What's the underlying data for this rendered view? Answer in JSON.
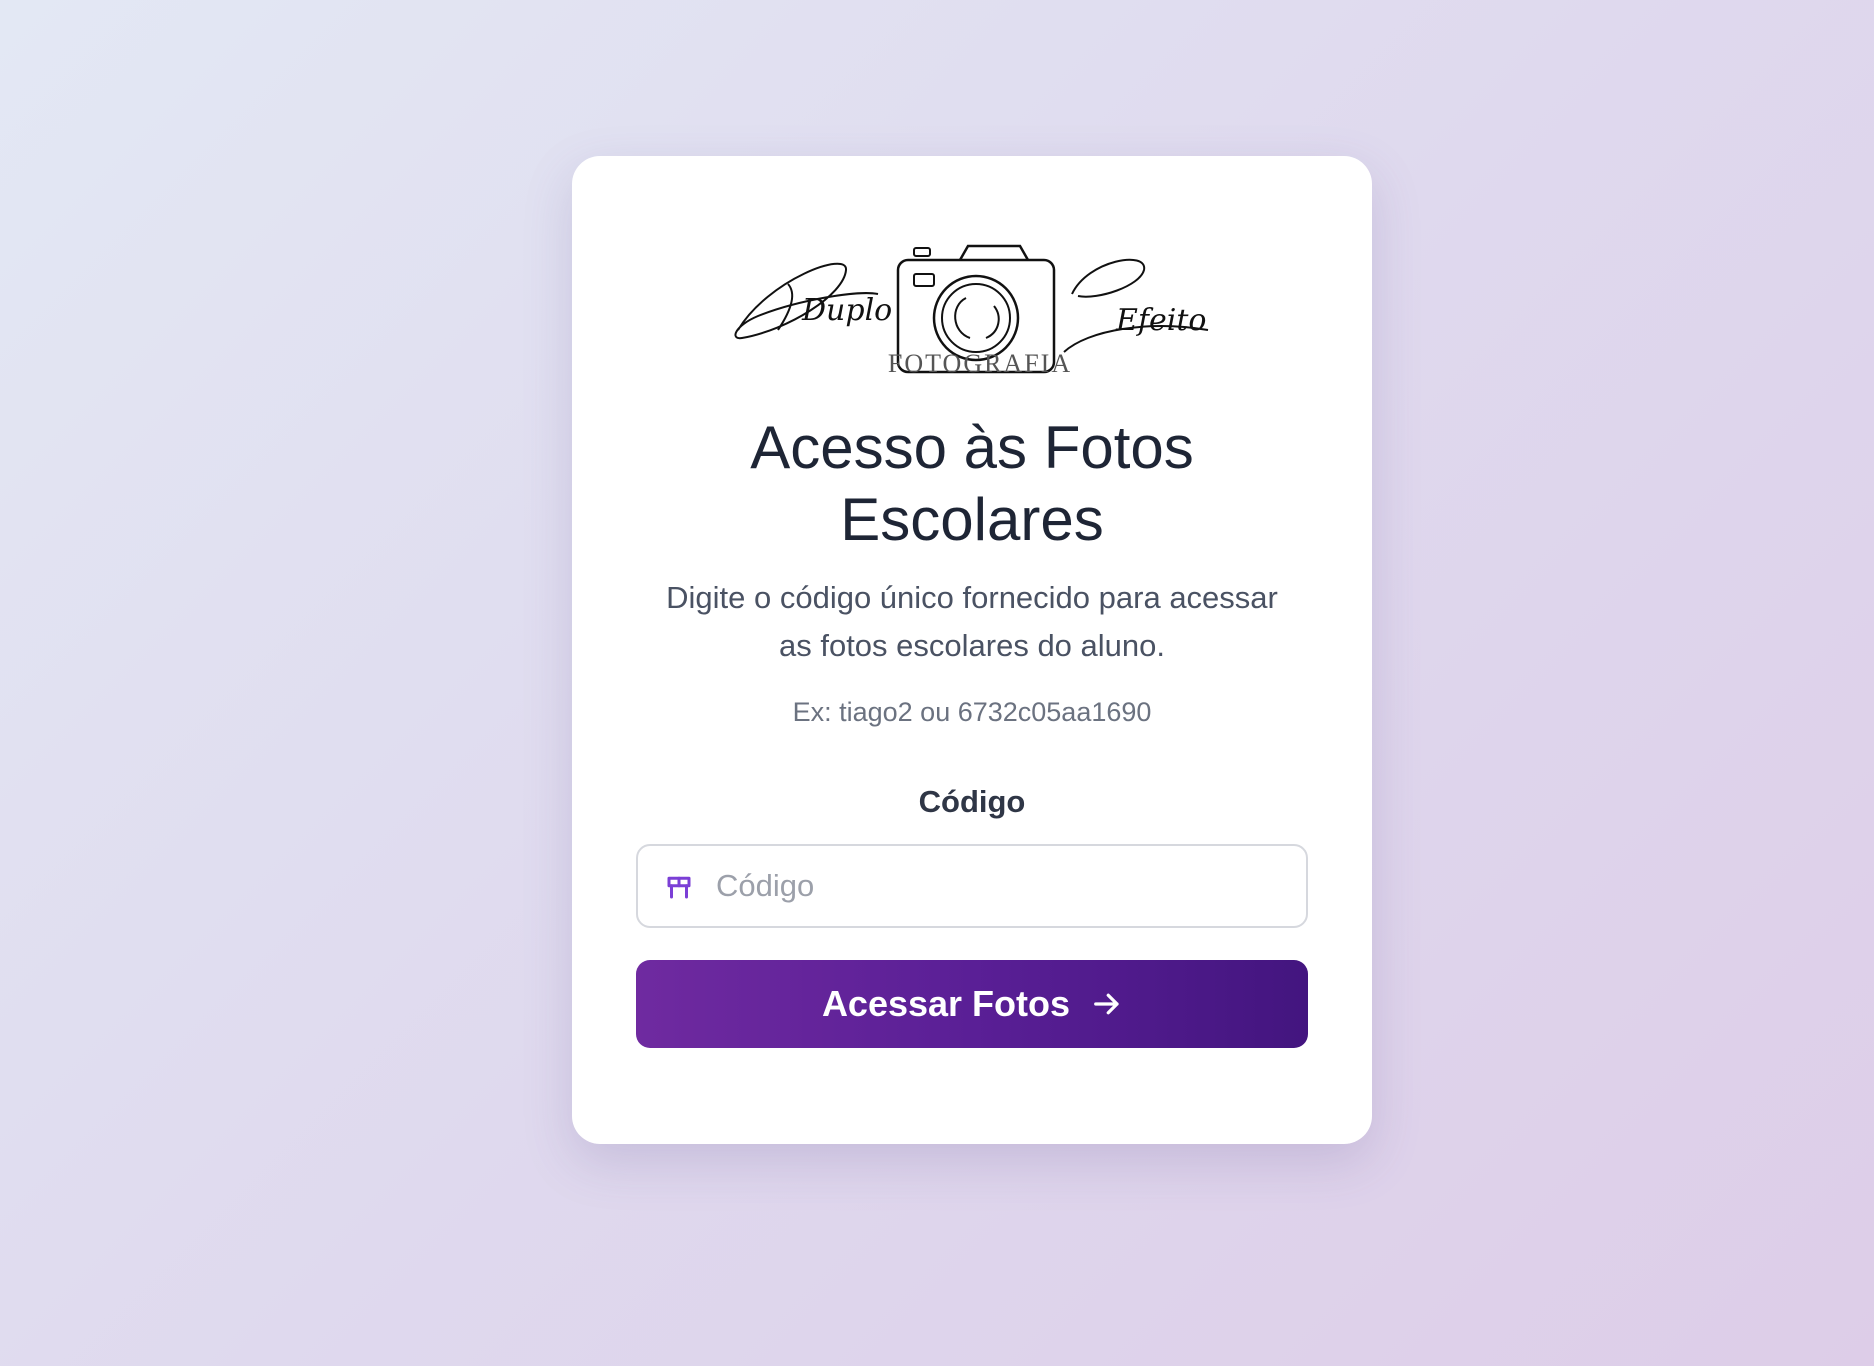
{
  "logo": {
    "script_left": "Duplo",
    "script_right": "Efeito",
    "subtitle": "FOTOGRAFIA",
    "icon": "camera-icon"
  },
  "header": {
    "title_line1": "Acesso às Fotos",
    "title_line2": "Escolares",
    "description_line1": "Digite o código único fornecido para acessar",
    "description_line2": "as fotos escolares do aluno.",
    "example": "Ex: tiago2 ou 6732c05aa1690"
  },
  "form": {
    "code_label": "Código",
    "code_value": "",
    "code_placeholder": "Código",
    "code_icon": "ticket-icon",
    "submit_label": "Acessar Fotos",
    "submit_icon": "arrow-right-icon"
  },
  "colors": {
    "accent": "#6f2aa0",
    "accent_dark": "#43157f",
    "icon": "#7b3fd6",
    "title": "#1e2535"
  }
}
